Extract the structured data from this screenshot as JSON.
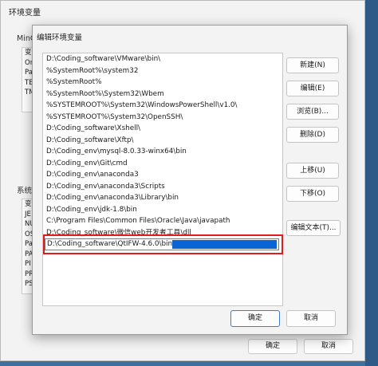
{
  "parent_window": {
    "title": "环境变量",
    "user_group_label": "MinG",
    "user_rows": [
      "变",
      "On",
      "Pa",
      "TE",
      "TM"
    ],
    "system_group_label": "系统变",
    "system_rows": [
      "变",
      "JE",
      "NU",
      "OS",
      "Pa",
      "PA",
      "PI",
      "PR",
      "PS"
    ],
    "ok_label": "确定",
    "cancel_label": "取消"
  },
  "dialog": {
    "title": "编辑环境变量",
    "paths": [
      "D:\\Coding_software\\VMware\\bin\\",
      "%SystemRoot%\\system32",
      "%SystemRoot%",
      "%SystemRoot%\\System32\\Wbem",
      "%SYSTEMROOT%\\System32\\WindowsPowerShell\\v1.0\\",
      "%SYSTEMROOT%\\System32\\OpenSSH\\",
      "D:\\Coding_software\\Xshell\\",
      "D:\\Coding_software\\Xftp\\",
      "D:\\Coding_env\\mysql-8.0.33-winx64\\bin",
      "D:\\Coding_env\\Git\\cmd",
      "D:\\Coding_env\\anaconda3",
      "D:\\Coding_env\\anaconda3\\Scripts",
      "D:\\Coding_env\\anaconda3\\Library\\bin",
      "D:\\Coding_env\\jdk-1.8\\bin",
      "C:\\Program Files\\Common Files\\Oracle\\Java\\javapath",
      "D:\\Coding_software\\微信web开发者工具\\dll"
    ],
    "editing_value": "D:\\Coding_software\\QtIFW-4.6.0\\bin",
    "buttons": {
      "new": "新建(N)",
      "edit": "编辑(E)",
      "browse": "浏览(B)...",
      "delete": "删除(D)",
      "move_up": "上移(U)",
      "move_down": "下移(O)",
      "edit_text": "编辑文本(T)..."
    },
    "ok_label": "确定",
    "cancel_label": "取消"
  },
  "colors": {
    "highlight_border": "#e01c1c",
    "selection": "#0a64d4"
  }
}
